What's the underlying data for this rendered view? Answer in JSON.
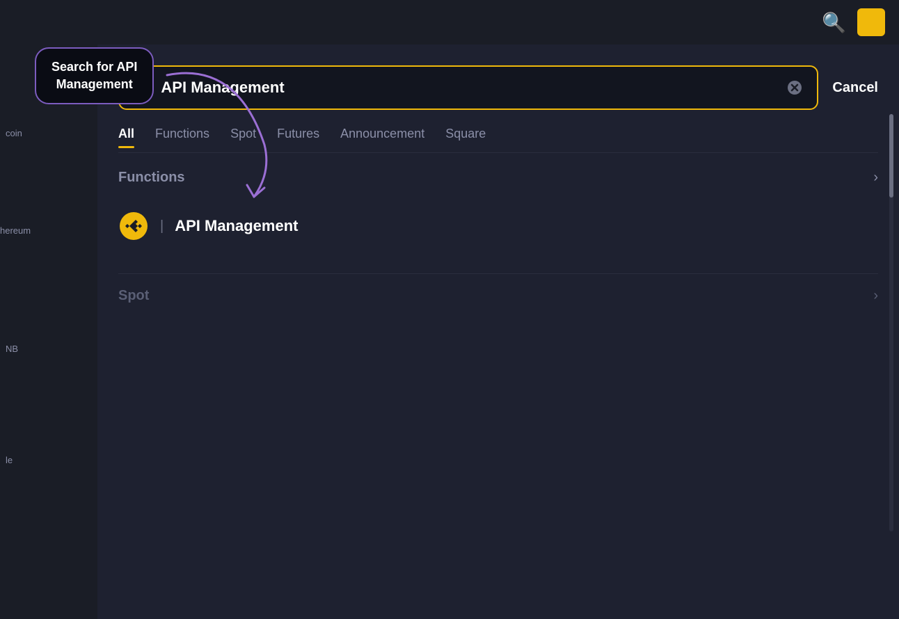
{
  "topbar": {
    "search_icon": "🔍",
    "avatar_color": "#f0b90b"
  },
  "tooltip": {
    "text": "Search for API\nManagement",
    "border_color": "#7c5cbf"
  },
  "search": {
    "value": "API Management",
    "placeholder": "Search",
    "clear_label": "✕",
    "cancel_label": "Cancel"
  },
  "filter_tabs": [
    {
      "id": "all",
      "label": "All",
      "active": true
    },
    {
      "id": "functions",
      "label": "Functions",
      "active": false
    },
    {
      "id": "spot",
      "label": "Spot",
      "active": false
    },
    {
      "id": "futures",
      "label": "Futures",
      "active": false
    },
    {
      "id": "announcement",
      "label": "Announcement",
      "active": false
    },
    {
      "id": "square",
      "label": "Square",
      "active": false
    }
  ],
  "results": {
    "functions_section": {
      "title": "Functions",
      "arrow": "›",
      "items": [
        {
          "icon": "🟡",
          "separator": "|",
          "text": "API Management"
        }
      ]
    },
    "spot_section": {
      "title": "Spot",
      "arrow": "›"
    }
  },
  "sidebar": {
    "partial_labels": [
      "coin",
      "hereum",
      "NB",
      "le"
    ]
  }
}
